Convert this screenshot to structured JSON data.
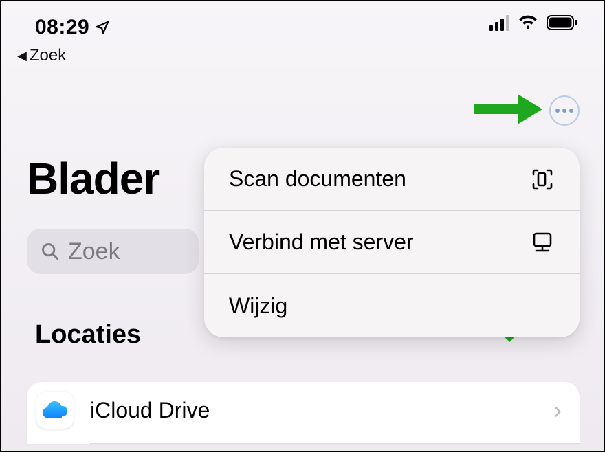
{
  "status": {
    "time": "08:29"
  },
  "breadcrumb": {
    "label": "Zoek"
  },
  "page": {
    "title": "Blader"
  },
  "search": {
    "placeholder": "Zoek"
  },
  "sections": {
    "locations_label": "Locaties"
  },
  "list": {
    "items": [
      {
        "label": "iCloud Drive"
      }
    ]
  },
  "menu": {
    "items": [
      {
        "label": "Scan documenten",
        "icon": "scan-document-icon"
      },
      {
        "label": "Verbind met server",
        "icon": "server-icon"
      },
      {
        "label": "Wijzig",
        "icon": ""
      }
    ]
  },
  "annotation": {
    "arrow_color": "#1fa81f"
  }
}
